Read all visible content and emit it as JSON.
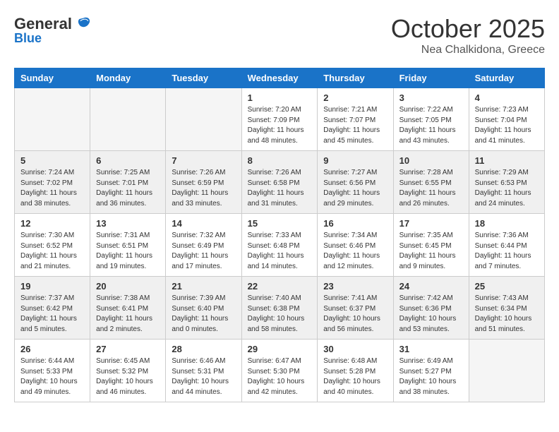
{
  "logo": {
    "line1": "General",
    "line2": "Blue"
  },
  "title": "October 2025",
  "subtitle": "Nea Chalkidona, Greece",
  "weekdays": [
    "Sunday",
    "Monday",
    "Tuesday",
    "Wednesday",
    "Thursday",
    "Friday",
    "Saturday"
  ],
  "weeks": [
    {
      "shaded": false,
      "days": [
        {
          "num": "",
          "info": ""
        },
        {
          "num": "",
          "info": ""
        },
        {
          "num": "",
          "info": ""
        },
        {
          "num": "1",
          "info": "Sunrise: 7:20 AM\nSunset: 7:09 PM\nDaylight: 11 hours and 48 minutes."
        },
        {
          "num": "2",
          "info": "Sunrise: 7:21 AM\nSunset: 7:07 PM\nDaylight: 11 hours and 45 minutes."
        },
        {
          "num": "3",
          "info": "Sunrise: 7:22 AM\nSunset: 7:05 PM\nDaylight: 11 hours and 43 minutes."
        },
        {
          "num": "4",
          "info": "Sunrise: 7:23 AM\nSunset: 7:04 PM\nDaylight: 11 hours and 41 minutes."
        }
      ]
    },
    {
      "shaded": true,
      "days": [
        {
          "num": "5",
          "info": "Sunrise: 7:24 AM\nSunset: 7:02 PM\nDaylight: 11 hours and 38 minutes."
        },
        {
          "num": "6",
          "info": "Sunrise: 7:25 AM\nSunset: 7:01 PM\nDaylight: 11 hours and 36 minutes."
        },
        {
          "num": "7",
          "info": "Sunrise: 7:26 AM\nSunset: 6:59 PM\nDaylight: 11 hours and 33 minutes."
        },
        {
          "num": "8",
          "info": "Sunrise: 7:26 AM\nSunset: 6:58 PM\nDaylight: 11 hours and 31 minutes."
        },
        {
          "num": "9",
          "info": "Sunrise: 7:27 AM\nSunset: 6:56 PM\nDaylight: 11 hours and 29 minutes."
        },
        {
          "num": "10",
          "info": "Sunrise: 7:28 AM\nSunset: 6:55 PM\nDaylight: 11 hours and 26 minutes."
        },
        {
          "num": "11",
          "info": "Sunrise: 7:29 AM\nSunset: 6:53 PM\nDaylight: 11 hours and 24 minutes."
        }
      ]
    },
    {
      "shaded": false,
      "days": [
        {
          "num": "12",
          "info": "Sunrise: 7:30 AM\nSunset: 6:52 PM\nDaylight: 11 hours and 21 minutes."
        },
        {
          "num": "13",
          "info": "Sunrise: 7:31 AM\nSunset: 6:51 PM\nDaylight: 11 hours and 19 minutes."
        },
        {
          "num": "14",
          "info": "Sunrise: 7:32 AM\nSunset: 6:49 PM\nDaylight: 11 hours and 17 minutes."
        },
        {
          "num": "15",
          "info": "Sunrise: 7:33 AM\nSunset: 6:48 PM\nDaylight: 11 hours and 14 minutes."
        },
        {
          "num": "16",
          "info": "Sunrise: 7:34 AM\nSunset: 6:46 PM\nDaylight: 11 hours and 12 minutes."
        },
        {
          "num": "17",
          "info": "Sunrise: 7:35 AM\nSunset: 6:45 PM\nDaylight: 11 hours and 9 minutes."
        },
        {
          "num": "18",
          "info": "Sunrise: 7:36 AM\nSunset: 6:44 PM\nDaylight: 11 hours and 7 minutes."
        }
      ]
    },
    {
      "shaded": true,
      "days": [
        {
          "num": "19",
          "info": "Sunrise: 7:37 AM\nSunset: 6:42 PM\nDaylight: 11 hours and 5 minutes."
        },
        {
          "num": "20",
          "info": "Sunrise: 7:38 AM\nSunset: 6:41 PM\nDaylight: 11 hours and 2 minutes."
        },
        {
          "num": "21",
          "info": "Sunrise: 7:39 AM\nSunset: 6:40 PM\nDaylight: 11 hours and 0 minutes."
        },
        {
          "num": "22",
          "info": "Sunrise: 7:40 AM\nSunset: 6:38 PM\nDaylight: 10 hours and 58 minutes."
        },
        {
          "num": "23",
          "info": "Sunrise: 7:41 AM\nSunset: 6:37 PM\nDaylight: 10 hours and 56 minutes."
        },
        {
          "num": "24",
          "info": "Sunrise: 7:42 AM\nSunset: 6:36 PM\nDaylight: 10 hours and 53 minutes."
        },
        {
          "num": "25",
          "info": "Sunrise: 7:43 AM\nSunset: 6:34 PM\nDaylight: 10 hours and 51 minutes."
        }
      ]
    },
    {
      "shaded": false,
      "days": [
        {
          "num": "26",
          "info": "Sunrise: 6:44 AM\nSunset: 5:33 PM\nDaylight: 10 hours and 49 minutes."
        },
        {
          "num": "27",
          "info": "Sunrise: 6:45 AM\nSunset: 5:32 PM\nDaylight: 10 hours and 46 minutes."
        },
        {
          "num": "28",
          "info": "Sunrise: 6:46 AM\nSunset: 5:31 PM\nDaylight: 10 hours and 44 minutes."
        },
        {
          "num": "29",
          "info": "Sunrise: 6:47 AM\nSunset: 5:30 PM\nDaylight: 10 hours and 42 minutes."
        },
        {
          "num": "30",
          "info": "Sunrise: 6:48 AM\nSunset: 5:28 PM\nDaylight: 10 hours and 40 minutes."
        },
        {
          "num": "31",
          "info": "Sunrise: 6:49 AM\nSunset: 5:27 PM\nDaylight: 10 hours and 38 minutes."
        },
        {
          "num": "",
          "info": ""
        }
      ]
    }
  ]
}
